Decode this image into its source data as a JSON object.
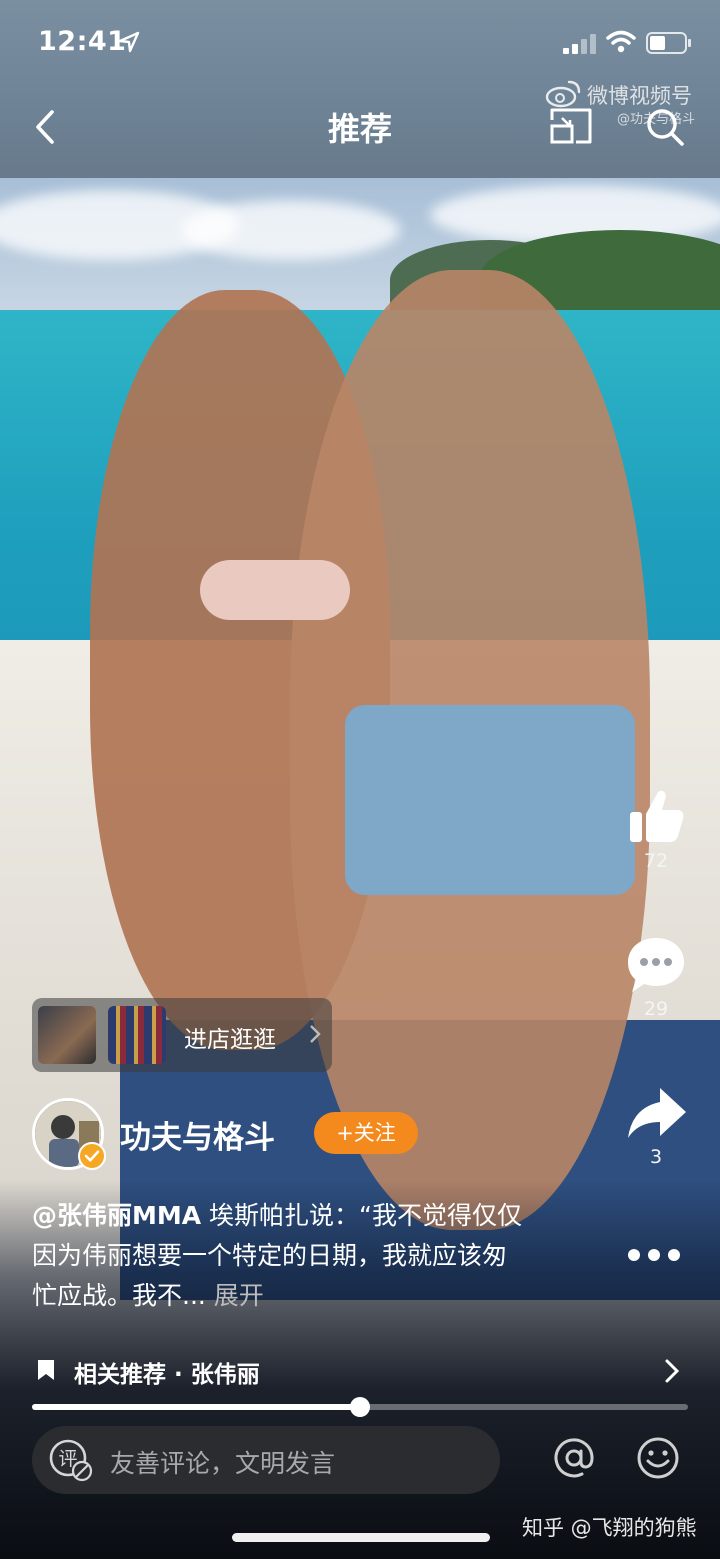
{
  "status_bar": {
    "time": "12:41"
  },
  "nav": {
    "title": "推荐"
  },
  "watermark": {
    "brand": "微博视频号",
    "handle": "@功夫与格斗"
  },
  "actions": {
    "likes": "72",
    "comments": "29",
    "shares": "3"
  },
  "shop": {
    "label": "进店逛逛"
  },
  "author": {
    "name": "功夫与格斗",
    "follow_label": "+关注"
  },
  "caption": {
    "mention": "@张伟丽MMA",
    "text": " 埃斯帕扎说：“我不觉得仅仅因为伟丽想要一个特定的日期，我就应该匆忙应战。我不...",
    "expand": "展开"
  },
  "related": {
    "label": "相关推荐 · 张伟丽"
  },
  "progress": {
    "fraction": 0.5
  },
  "comment": {
    "placeholder": "友善评论，文明发言"
  },
  "zhihu_watermark": "知乎 @飞翔的狗熊",
  "colors": {
    "follow": "#f48a1e",
    "verified": "#f6a723"
  }
}
